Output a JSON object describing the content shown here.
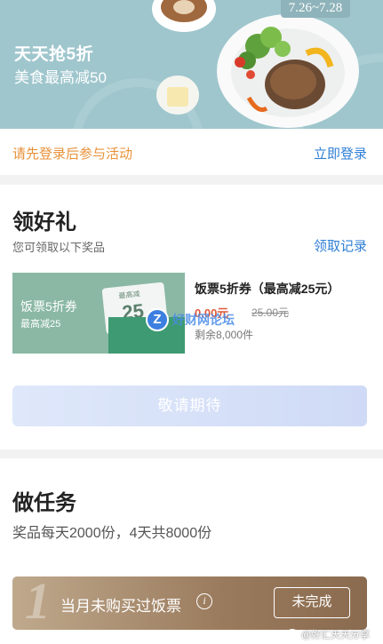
{
  "banner": {
    "title": "天天抢5折",
    "subtitle": "美食最高减50",
    "date_range": "7.26~7.28"
  },
  "login_bar": {
    "hint": "请先登录后参与活动",
    "login_link": "立即登录"
  },
  "gifts": {
    "heading": "领好礼",
    "description": "您可领取以下奖品",
    "records_link": "领取记录",
    "coupon": {
      "image_title": "饭票5折券",
      "image_subtitle": "最高减25",
      "ticket_label": "最高减",
      "ticket_value": "25",
      "name": "饭票5折券（最高减25元）",
      "price": "0.00元",
      "original_price": "25.00元",
      "remaining": "剩余8,000件"
    },
    "await_button": "敬请期待"
  },
  "watermark": {
    "icon_letter": "Z",
    "text": "好财网论坛"
  },
  "tasks": {
    "heading": "做任务",
    "description": "奖品每天2000份，4天共8000份",
    "items": [
      {
        "number": "1",
        "name": "当月未购买过饭票",
        "info_symbol": "i",
        "status": "未完成"
      }
    ]
  },
  "weibo_watermark": "@好汇天天分享",
  "colors": {
    "banner_bg": "#9fc6cd",
    "hint_orange": "#e8923a",
    "link_blue": "#2f7fd6",
    "price_red": "#e05a3a",
    "task_card_gold": "#9a7a5c"
  },
  "icons": [
    "coffee-cup-icon",
    "steak-plate-icon",
    "info-icon",
    "z-logo-icon",
    "weibo-icon"
  ]
}
